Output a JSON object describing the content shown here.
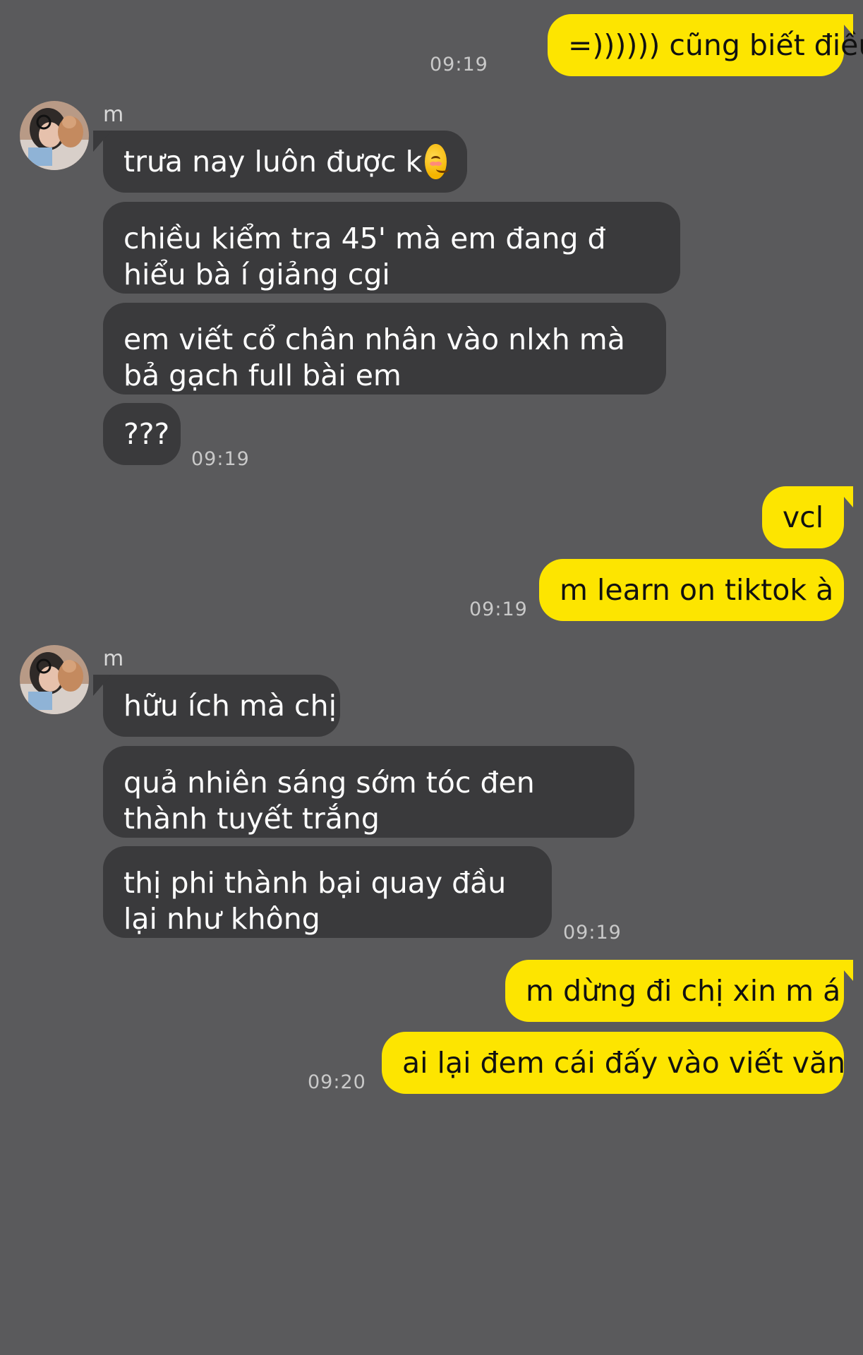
{
  "contact": {
    "name": "m"
  },
  "avatar_icon": "contact-avatar-photo",
  "colors": {
    "background": "#5a5a5c",
    "incoming_bubble": "#3a3a3c",
    "outgoing_bubble": "#fde500",
    "incoming_text": "#ffffff",
    "outgoing_text": "#111111",
    "timestamp": "#c9c9c9"
  },
  "messages": [
    {
      "direction": "out",
      "text": "=)))))) cũng biết điều",
      "time": "09:19"
    },
    {
      "direction": "in",
      "text": "trưa nay luôn được k",
      "emoji": "smiling-face-emoji"
    },
    {
      "direction": "in",
      "text": "chiều kiểm tra 45' mà em đang đ hiểu bà í giảng cgi"
    },
    {
      "direction": "in",
      "text": "em viết cổ chân nhân vào nlxh mà bả gạch full bài em"
    },
    {
      "direction": "in",
      "text": "???",
      "time": "09:19"
    },
    {
      "direction": "out",
      "text": "vcl"
    },
    {
      "direction": "out",
      "text": "m learn on tiktok à",
      "time": "09:19"
    },
    {
      "direction": "in",
      "text": "hữu ích mà chị"
    },
    {
      "direction": "in",
      "text": "quả nhiên sáng sớm tóc đen thành tuyết trắng"
    },
    {
      "direction": "in",
      "text": "thị phi thành bại quay đầu lại như không",
      "time": "09:19"
    },
    {
      "direction": "out",
      "text": "m dừng đi chị xin m á"
    },
    {
      "direction": "out",
      "text": "ai lại đem cái đấy vào viết văn",
      "time": "09:20"
    }
  ]
}
